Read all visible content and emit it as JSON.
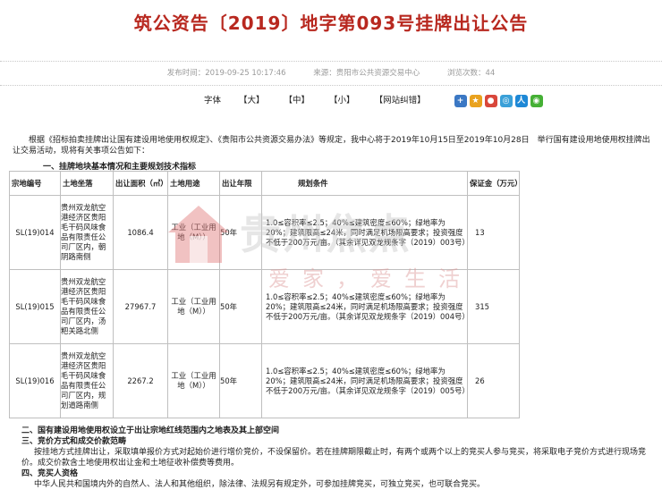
{
  "title": "筑公资告〔2019〕地字第093号挂牌出让公告",
  "meta": {
    "publish_time": "发布时间：2019-09-25 10:17:46",
    "source": "来源：贵阳市公共资源交易中心",
    "views": "浏览次数：44"
  },
  "toolbar": {
    "font_label": "字体",
    "large": "【大】",
    "medium": "【中】",
    "small": "【小】",
    "report": "【网站纠错】"
  },
  "intro": "根据《招标拍卖挂牌出让国有建设用地使用权规定》、《贵阳市公共资源交易办法》等规定，我中心将于2019年10月15日至2019年10月28日　举行国有建设用地使用权挂牌出让交易活动，现将有关事项公告如下：",
  "section1_title": "一、挂牌地块基本情况和主要规划技术指标",
  "table": {
    "headers": [
      "宗地编号",
      "土地坐落",
      "出让面积（㎡）",
      "土地用途",
      "出让年限",
      "规划条件",
      "保证金（万元）"
    ],
    "rows": [
      {
        "code": "SL(19)014",
        "location": "贵州双龙航空港经济区贵阳毛干码风味食品有限责任公司厂区内，朝阴路南侧",
        "area": "1086.4",
        "use": "工业（工业用地（M））",
        "years": "50年",
        "condition": "1.0≤容积率≤2.5；40%≤建筑密度≤60%；绿地率为20%；建筑限高≤24米，同时满足机场限高要求；投资强度不低于200万元/亩。（其余详见双龙规条字（2019）003号）",
        "deposit": "13"
      },
      {
        "code": "SL(19)015",
        "location": "贵州双龙航空港经济区贵阳毛干码风味食品有限责任公司厂区内，汤粑关路北侧",
        "area": "27967.7",
        "use": "工业（工业用地（M））",
        "years": "50年",
        "condition": "1.0≤容积率≤2.5；40%≤建筑密度≤60%；绿地率为20%；建筑限高≤24米，同时满足机场限高要求；投资强度不低于200万元/亩。（其余详见双龙规条字（2019）004号）",
        "deposit": "315"
      },
      {
        "code": "SL(19)016",
        "location": "贵州双龙航空港经济区贵阳毛干码风味食品有限责任公司厂区内，规划道路南侧",
        "area": "2267.2",
        "use": "工业（工业用地（M））",
        "years": "50年",
        "condition": "1.0≤容积率≤2.5；40%≤建筑密度≤60%；绿地率为20%；建筑限高≤24米，同时满足机场限高要求；投资强度不低于200万元/亩。（其余详见双龙规条字（2019）005号）",
        "deposit": "26"
      }
    ]
  },
  "section2_title": "二、国有建设用地使用权设立于出让宗地红线范围内之地表及其上部空间",
  "section3_title": "三、竞价方式和成交价款范畴",
  "section3_body": "按挂地方式挂牌出让，采取填单报价方式对起始价进行增价竞价，不设保留价。若在挂牌期限截止时，有两个或两个以上的竞买人参与竞买，将采取电子竞价方式进行现场竞价。成交价款含土地使用权出让金和土地征收补偿费等费用。",
  "section4_title": "四、竞买人资格",
  "section4_body": "中华人民共和国境内外的自然人、法人和其他组织，除法律、法规另有规定外，可参加挂牌竞买，可独立竞买，也可联合竞买。",
  "watermark": {
    "brand": "贵州焦点",
    "slogan": "爱家，爱生活"
  }
}
